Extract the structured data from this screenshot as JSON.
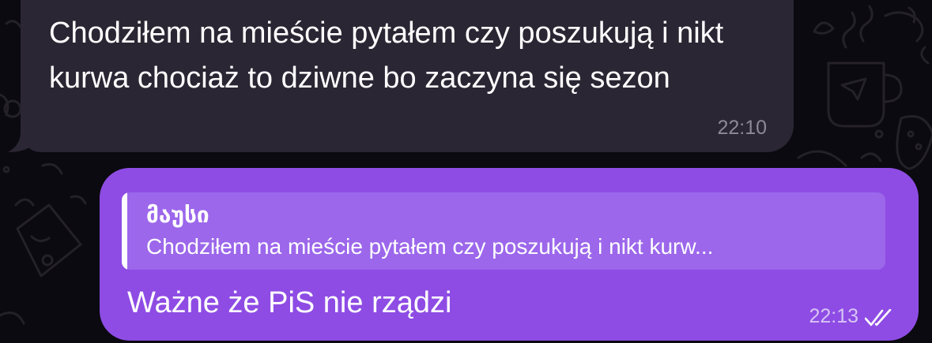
{
  "incoming_message": {
    "text": "Chodziłem na mieście pytałem czy poszukują i nikt kurwa chociaż to dziwne bo zaczyna się sezon",
    "time": "22:10"
  },
  "outgoing_message": {
    "reply": {
      "author": "მაუსი",
      "text": "Chodziłem na mieście pytałem czy poszukują i nikt kurw..."
    },
    "text": "Ważne że PiS nie rządzi",
    "time": "22:13",
    "status_icon": "double-check-read-icon"
  },
  "colors": {
    "background": "#0b0a10",
    "incoming_bubble": "#2b2633",
    "outgoing_bubble": "#8e4ce4",
    "reply_quote": "#9c67eb"
  }
}
